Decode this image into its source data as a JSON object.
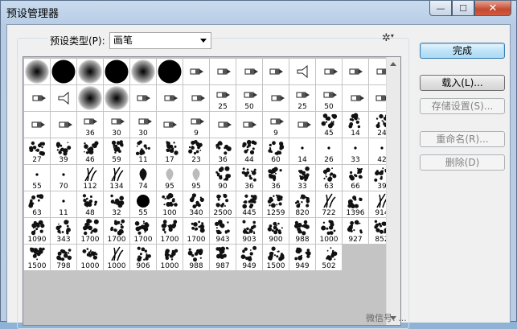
{
  "window": {
    "title": "预设管理器",
    "min_glyph": "—",
    "max_glyph": "☐",
    "close_glyph": "✕"
  },
  "preset_type": {
    "label": "预设类型(P):",
    "selected": "画笔",
    "gear_glyph": "✲"
  },
  "buttons": {
    "done": "完成",
    "load": "载入(L)...",
    "save_set": "存储设置(S)...",
    "rename": "重命名(R)...",
    "delete": "删除(D)"
  },
  "brush_cells": [
    {
      "kind": "soft"
    },
    {
      "kind": "hard"
    },
    {
      "kind": "soft"
    },
    {
      "kind": "hard"
    },
    {
      "kind": "soft"
    },
    {
      "kind": "hard"
    },
    {
      "kind": "tool"
    },
    {
      "kind": "tool"
    },
    {
      "kind": "tool"
    },
    {
      "kind": "tool"
    },
    {
      "kind": "fan"
    },
    {
      "kind": "tool"
    },
    {
      "kind": "tool"
    },
    {
      "kind": "tool"
    },
    {
      "kind": "tool"
    },
    {
      "kind": "fan"
    },
    {
      "kind": "soft"
    },
    {
      "kind": "soft"
    },
    {
      "kind": "tool"
    },
    {
      "kind": "tool"
    },
    {
      "kind": "tool"
    },
    {
      "kind": "tool",
      "num": "25"
    },
    {
      "kind": "tool",
      "num": "50"
    },
    {
      "kind": "tool"
    },
    {
      "kind": "tool",
      "num": "25"
    },
    {
      "kind": "tool",
      "num": "50"
    },
    {
      "kind": "tool"
    },
    {
      "kind": "tool"
    },
    {
      "kind": "tool"
    },
    {
      "kind": "tool"
    },
    {
      "kind": "tool",
      "num": "36"
    },
    {
      "kind": "tool",
      "num": "30"
    },
    {
      "kind": "tool",
      "num": "30"
    },
    {
      "kind": "tool"
    },
    {
      "kind": "tool",
      "num": "9"
    },
    {
      "kind": "tool"
    },
    {
      "kind": "tool"
    },
    {
      "kind": "tool",
      "num": "9"
    },
    {
      "kind": "tool"
    },
    {
      "kind": "splat",
      "num": "45"
    },
    {
      "kind": "splat",
      "num": "14"
    },
    {
      "kind": "splat",
      "num": "24"
    },
    {
      "kind": "splat",
      "num": "27"
    },
    {
      "kind": "splat",
      "num": "39"
    },
    {
      "kind": "splat",
      "num": "46"
    },
    {
      "kind": "splat",
      "num": "59"
    },
    {
      "kind": "splat",
      "num": "11"
    },
    {
      "kind": "splat",
      "num": "17"
    },
    {
      "kind": "splat",
      "num": "23"
    },
    {
      "kind": "splat",
      "num": "36"
    },
    {
      "kind": "splat",
      "num": "44"
    },
    {
      "kind": "splat",
      "num": "60"
    },
    {
      "kind": "dot",
      "num": "14"
    },
    {
      "kind": "dot",
      "num": "26"
    },
    {
      "kind": "dot",
      "num": "33"
    },
    {
      "kind": "dot",
      "num": "42"
    },
    {
      "kind": "dot",
      "num": "55"
    },
    {
      "kind": "dot",
      "num": "70"
    },
    {
      "kind": "grass",
      "num": "112"
    },
    {
      "kind": "grass",
      "num": "134"
    },
    {
      "kind": "leaf",
      "num": "74"
    },
    {
      "kind": "leaf",
      "num": "95"
    },
    {
      "kind": "leaf",
      "num": "95"
    },
    {
      "kind": "splat",
      "num": "90"
    },
    {
      "kind": "splat",
      "num": "36"
    },
    {
      "kind": "splat",
      "num": "36"
    },
    {
      "kind": "splat",
      "num": "33"
    },
    {
      "kind": "splat",
      "num": "63"
    },
    {
      "kind": "splat",
      "num": "66"
    },
    {
      "kind": "splat",
      "num": "39"
    },
    {
      "kind": "splat",
      "num": "63"
    },
    {
      "kind": "dot",
      "num": "11"
    },
    {
      "kind": "splat",
      "num": "48"
    },
    {
      "kind": "splat",
      "num": "32"
    },
    {
      "kind": "hard",
      "num": "55"
    },
    {
      "kind": "splat",
      "num": "100"
    },
    {
      "kind": "splat",
      "num": "340"
    },
    {
      "kind": "splat",
      "num": "2500"
    },
    {
      "kind": "splat",
      "num": "445"
    },
    {
      "kind": "splat",
      "num": "1259"
    },
    {
      "kind": "splat",
      "num": "820"
    },
    {
      "kind": "grass",
      "num": "722"
    },
    {
      "kind": "splat",
      "num": "1396"
    },
    {
      "kind": "grass",
      "num": "914"
    },
    {
      "kind": "splat",
      "num": "1090"
    },
    {
      "kind": "splat",
      "num": "343"
    },
    {
      "kind": "splat",
      "num": "1700"
    },
    {
      "kind": "splat",
      "num": "1700"
    },
    {
      "kind": "splat",
      "num": "1700"
    },
    {
      "kind": "splat",
      "num": "1700"
    },
    {
      "kind": "splat",
      "num": "1700"
    },
    {
      "kind": "splat",
      "num": "943"
    },
    {
      "kind": "splat",
      "num": "903"
    },
    {
      "kind": "splat",
      "num": "900"
    },
    {
      "kind": "splat",
      "num": "988"
    },
    {
      "kind": "splat",
      "num": "1000"
    },
    {
      "kind": "splat",
      "num": "927"
    },
    {
      "kind": "splat",
      "num": "852"
    },
    {
      "kind": "splat",
      "num": "1500"
    },
    {
      "kind": "splat",
      "num": "798"
    },
    {
      "kind": "splat",
      "num": "1000"
    },
    {
      "kind": "grass",
      "num": "1000"
    },
    {
      "kind": "splat",
      "num": "906"
    },
    {
      "kind": "splat",
      "num": "1000"
    },
    {
      "kind": "splat",
      "num": "988"
    },
    {
      "kind": "splat",
      "num": "987"
    },
    {
      "kind": "splat",
      "num": "949"
    },
    {
      "kind": "splat",
      "num": "1500"
    },
    {
      "kind": "splat",
      "num": "949"
    },
    {
      "kind": "splat",
      "num": "502"
    }
  ],
  "watermark": "微信号: ..."
}
